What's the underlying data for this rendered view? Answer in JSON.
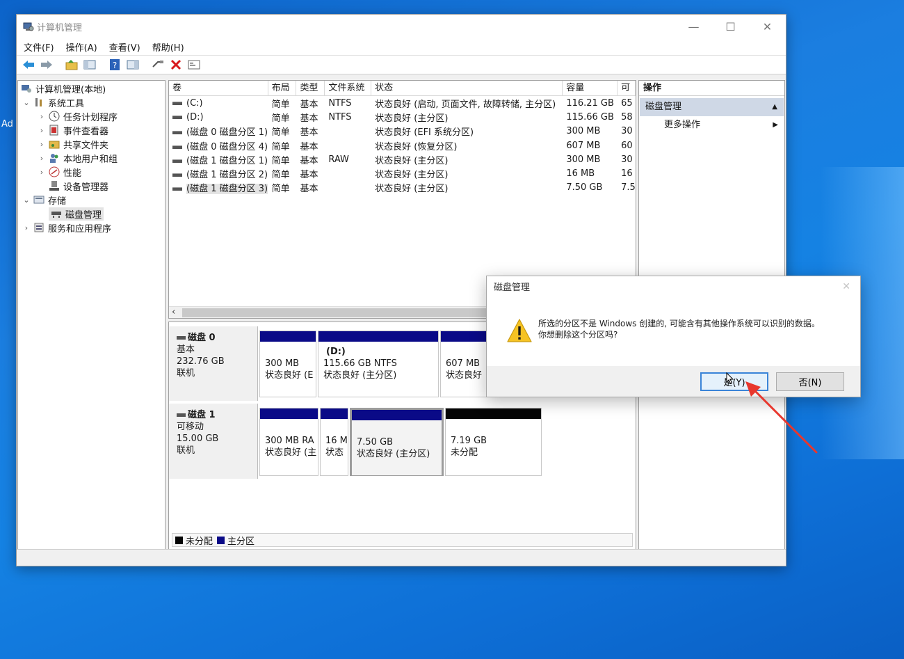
{
  "desktop": {
    "edge_text": "Ad"
  },
  "window": {
    "title": "计算机管理",
    "controls": {
      "minimize": "—",
      "maximize": "☐",
      "close": "✕"
    }
  },
  "menu": [
    "文件(F)",
    "操作(A)",
    "查看(V)",
    "帮助(H)"
  ],
  "tree": {
    "root": "计算机管理(本地)",
    "system_tools": "系统工具",
    "task_scheduler": "任务计划程序",
    "event_viewer": "事件查看器",
    "shared_folders": "共享文件夹",
    "local_users": "本地用户和组",
    "performance": "性能",
    "device_manager": "设备管理器",
    "storage": "存储",
    "disk_management": "磁盘管理",
    "services": "服务和应用程序"
  },
  "volume_list": {
    "headers": [
      "卷",
      "布局",
      "类型",
      "文件系统",
      "状态",
      "容量",
      "可"
    ],
    "rows": [
      [
        "(C:)",
        "简单",
        "基本",
        "NTFS",
        "状态良好 (启动, 页面文件, 故障转储, 主分区)",
        "116.21 GB",
        "65"
      ],
      [
        "(D:)",
        "简单",
        "基本",
        "NTFS",
        "状态良好 (主分区)",
        "115.66 GB",
        "58"
      ],
      [
        "(磁盘 0 磁盘分区 1)",
        "简单",
        "基本",
        "",
        "状态良好 (EFI 系统分区)",
        "300 MB",
        "30"
      ],
      [
        "(磁盘 0 磁盘分区 4)",
        "简单",
        "基本",
        "",
        "状态良好 (恢复分区)",
        "607 MB",
        "60"
      ],
      [
        "(磁盘 1 磁盘分区 1)",
        "简单",
        "基本",
        "RAW",
        "状态良好 (主分区)",
        "300 MB",
        "30"
      ],
      [
        "(磁盘 1 磁盘分区 2)",
        "简单",
        "基本",
        "",
        "状态良好 (主分区)",
        "16 MB",
        "16"
      ],
      [
        "(磁盘 1 磁盘分区 3)",
        "简单",
        "基本",
        "",
        "状态良好 (主分区)",
        "7.50 GB",
        "7.5"
      ]
    ]
  },
  "disks": [
    {
      "name": "磁盘 0",
      "type": "基本",
      "size": "232.76 GB",
      "state": "联机",
      "partitions": [
        {
          "title": "",
          "line1": "300 MB",
          "line2": "状态良好 (E"
        },
        {
          "title": "(D:)",
          "line1": "115.66 GB NTFS",
          "line2": "状态良好 (主分区)"
        },
        {
          "title": "",
          "line1": "607 MB",
          "line2": "状态良好"
        }
      ]
    },
    {
      "name": "磁盘 1",
      "type": "可移动",
      "size": "15.00 GB",
      "state": "联机",
      "partitions": [
        {
          "title": "",
          "line1": "300 MB RA",
          "line2": "状态良好 (主"
        },
        {
          "title": "",
          "line1": "16 M",
          "line2": "状态"
        },
        {
          "title": "",
          "line1": "7.50 GB",
          "line2": "状态良好 (主分区)"
        },
        {
          "title": "",
          "line1": "7.19 GB",
          "line2": "未分配"
        }
      ]
    }
  ],
  "legend": {
    "unallocated": "未分配",
    "primary": "主分区"
  },
  "actions": {
    "header": "操作",
    "group": "磁盘管理",
    "more": "更多操作"
  },
  "dialog": {
    "title": "磁盘管理",
    "message_line1": "所选的分区不是 Windows 创建的, 可能含有其他操作系统可以识别的数据。",
    "message_line2": "你想删除这个分区吗?",
    "yes_label": "是(Y)",
    "no_label": "否(N)"
  },
  "colors": {
    "primary_partition": "#0a0a87",
    "unallocated": "#050505",
    "annotation_arrow": "#e8372d"
  }
}
